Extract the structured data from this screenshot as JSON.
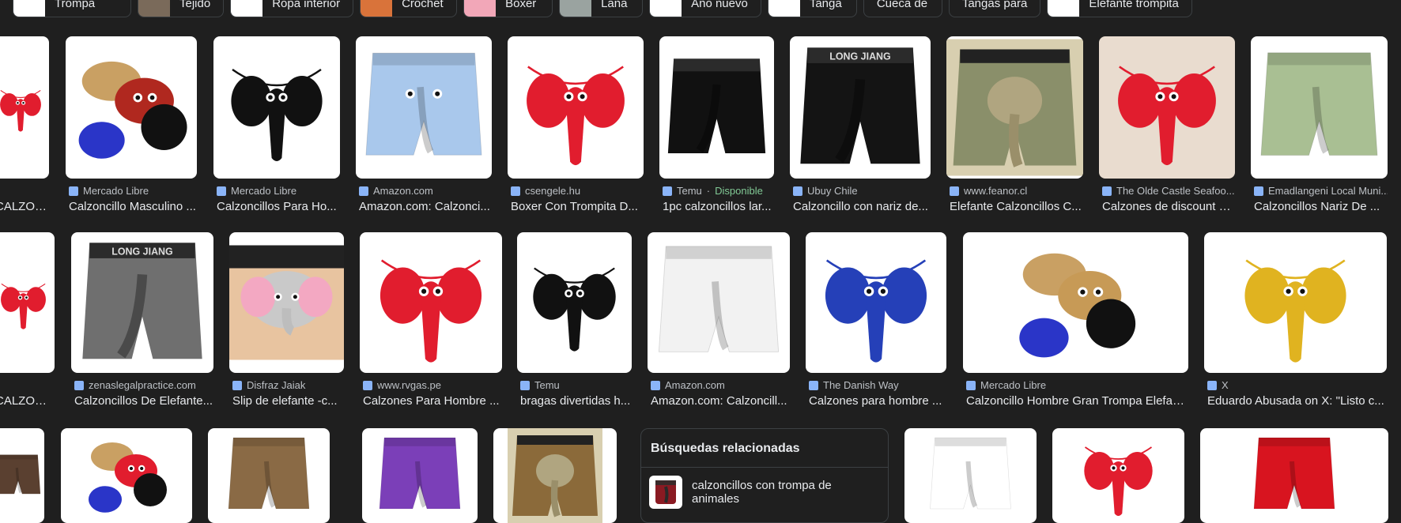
{
  "chips": [
    {
      "label": "Trompa",
      "thumb": "#ffffff"
    },
    {
      "label": "Tejido",
      "thumb": "#7a6a5a"
    },
    {
      "label": "Ropa interior",
      "thumb": "#ffffff"
    },
    {
      "label": "Crochet",
      "thumb": "#d9733a"
    },
    {
      "label": "Boxer",
      "thumb": "#f2a7b8"
    },
    {
      "label": "Lana",
      "thumb": "#9aa3a0"
    },
    {
      "label": "Año nuevo",
      "thumb": "#ffffff"
    },
    {
      "label": "Tanga",
      "thumb": "#ffffff"
    },
    {
      "label": "Cueca de",
      "thumb": ""
    },
    {
      "label": "Tangas para",
      "thumb": ""
    },
    {
      "label": "Elefante trompita",
      "thumb": "#ffffff"
    }
  ],
  "row1": [
    {
      "source": "",
      "title": "CALZONCILL...",
      "color": "#e11d2e",
      "bg": "#ffffff",
      "icon": "red-thong"
    },
    {
      "source": "Mercado Libre",
      "title": "Calzoncillo Masculino ...",
      "color": "#b0281f",
      "bg": "#ffffff",
      "icon": "thong-set"
    },
    {
      "source": "Mercado Libre",
      "title": "Calzoncillos Para Ho...",
      "color": "#111111",
      "bg": "#ffffff",
      "icon": "black-thong"
    },
    {
      "source": "Amazon.com",
      "title": "Amazon.com: Calzonci...",
      "color": "#a9c8ec",
      "bg": "#ffffff",
      "icon": "blue-boxer"
    },
    {
      "source": "csengele.hu",
      "title": "Boxer Con Trompita D...",
      "color": "#e11d2e",
      "bg": "#ffffff",
      "icon": "red-thong"
    },
    {
      "source": "Temu",
      "status": "Disponible",
      "title": "1pc calzoncillos lar...",
      "color": "#111111",
      "bg": "#ffffff",
      "icon": "black-boxer"
    },
    {
      "source": "Ubuy Chile",
      "title": "Calzoncillo con nariz de...",
      "color": "#141414",
      "bg": "#ffffff",
      "icon": "black-boxer",
      "brand": "LONG JIANG"
    },
    {
      "source": "www.feanor.cl",
      "title": "Elefante Calzoncillos C...",
      "color": "#8a8f6a",
      "bg": "#ffffff",
      "icon": "print-boxer"
    },
    {
      "source": "The Olde Castle Seafoo...",
      "title": "Calzones de discount e...",
      "color": "#e11d2e",
      "bg": "#e9dccf",
      "icon": "red-thong"
    },
    {
      "source": "Emadlangeni Local Muni...",
      "title": "Calzoncillos Nariz De ...",
      "color": "#a9bf93",
      "bg": "#ffffff",
      "icon": "green-boxer"
    }
  ],
  "row2": [
    {
      "source": "",
      "title": "CALZONCILLO ...",
      "color": "#e11d2e",
      "bg": "#ffffff",
      "icon": "red-thong"
    },
    {
      "source": "zenaslegalpractice.com",
      "title": "Calzoncillos De Elefante...",
      "color": "#6f6f6f",
      "bg": "#ffffff",
      "icon": "grey-boxer",
      "brand": "LONG JIANG"
    },
    {
      "source": "Disfraz Jaiak",
      "title": "Slip de elefante -c...",
      "color": "#c9c9c9",
      "bg": "#ffffff",
      "icon": "plush"
    },
    {
      "source": "www.rvgas.pe",
      "title": "Calzones Para Hombre ...",
      "color": "#e11d2e",
      "bg": "#ffffff",
      "icon": "red-thong"
    },
    {
      "source": "Temu",
      "title": "bragas divertidas h...",
      "color": "#111111",
      "bg": "#ffffff",
      "icon": "black-thong"
    },
    {
      "source": "Amazon.com",
      "title": "Amazon.com: Calzoncill...",
      "color": "#f2f2f2",
      "bg": "#ffffff",
      "icon": "white-boxer"
    },
    {
      "source": "The Danish Way",
      "title": "Calzones para hombre ...",
      "color": "#2540b8",
      "bg": "#ffffff",
      "icon": "blue-thong"
    },
    {
      "source": "Mercado Libre",
      "title": "Calzoncillo Hombre Gran Trompa Elefan...",
      "color": "#c79a56",
      "bg": "#ffffff",
      "icon": "thong-set"
    },
    {
      "source": "X",
      "title": "Eduardo Abusada on X: \"Listo c...",
      "color": "#e0b320",
      "bg": "#ffffff",
      "icon": "gold-thong"
    }
  ],
  "row3": [
    {
      "color": "#5a4030",
      "icon": "brown"
    },
    {
      "color": "#e11d2e",
      "icon": "thong-set"
    },
    {
      "color": "#8a6a45",
      "icon": "leopard"
    },
    {
      "color": "#7b3fb8",
      "icon": "purple"
    },
    {
      "color": "#8b6a3a",
      "icon": "print-boxer"
    },
    {
      "color": "#ffffff",
      "icon": "white-boxer"
    },
    {
      "color": "#e11d2e",
      "icon": "red-thong"
    },
    {
      "color": "#d8141f",
      "icon": "red-boxer"
    }
  ],
  "related": {
    "heading": "Búsquedas relacionadas",
    "item": "calzoncillos con trompa de animales"
  }
}
